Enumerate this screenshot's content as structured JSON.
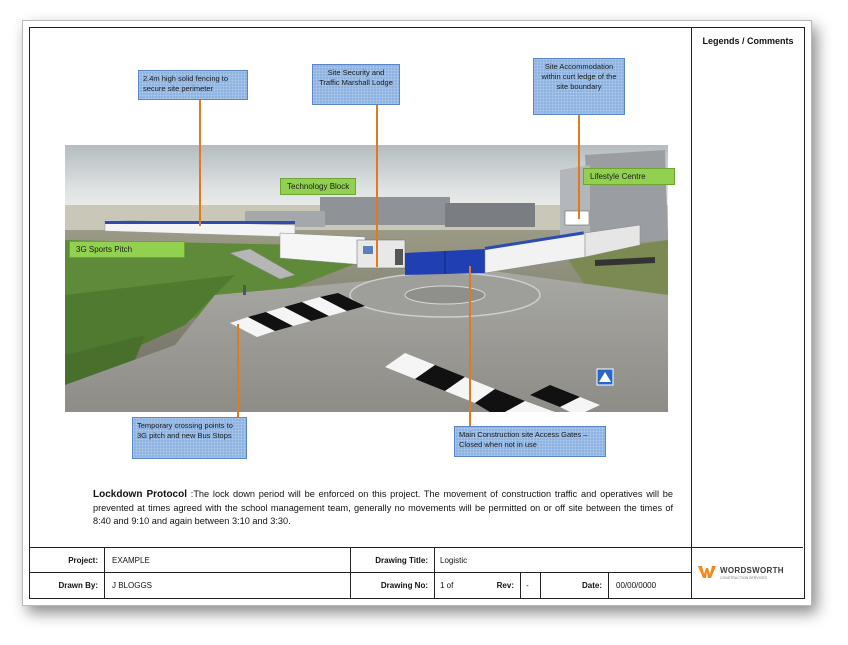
{
  "side_panel": {
    "title": "Legends / Comments"
  },
  "callouts": {
    "fencing": "2.4m high solid fencing to secure site perimeter",
    "security": "Site  Security  and Traffic Marshall Lodge",
    "accommodation": "Site Accommodation within curt ledge of the site boundary",
    "crossing": "Temporary crossing points to 3G pitch and new Bus Stops",
    "gates": "Main Construction site Access Gates – Closed when not in use"
  },
  "labels": {
    "technology_block": "Technology Block",
    "lifestyle_centre": "Lifestyle Centre",
    "sports_pitch": "3G Sports Pitch"
  },
  "protocol": {
    "heading": "Lockdown Protocol",
    "text": " :The lock down period will be enforced  on this project. The movement of construction traffic and operatives will be prevented at times agreed with the school management team, generally no movements will be permitted on or off site between the times of 8:40 and 9:10 and again between 3:10 and 3:30."
  },
  "title_block": {
    "project_label": "Project:",
    "project_value": "EXAMPLE",
    "drawn_by_label": "Drawn By:",
    "drawn_by_value": "J BLOGGS",
    "drawing_title_label": "Drawing Title:",
    "drawing_title_value": "Logistic",
    "drawing_no_label": "Drawing No:",
    "drawing_no_value": "1 of",
    "rev_label": "Rev:",
    "rev_value": "-",
    "date_label": "Date:",
    "date_value": "00/00/0000",
    "logo_text": "WORDSWORTH",
    "logo_subtext": "CONSTRUCTION SERVICES"
  },
  "colors": {
    "callout_blue": "#8db3e2",
    "leader_orange": "#e07a1f",
    "label_green": "#92d050",
    "logo_orange": "#f08a1c"
  }
}
